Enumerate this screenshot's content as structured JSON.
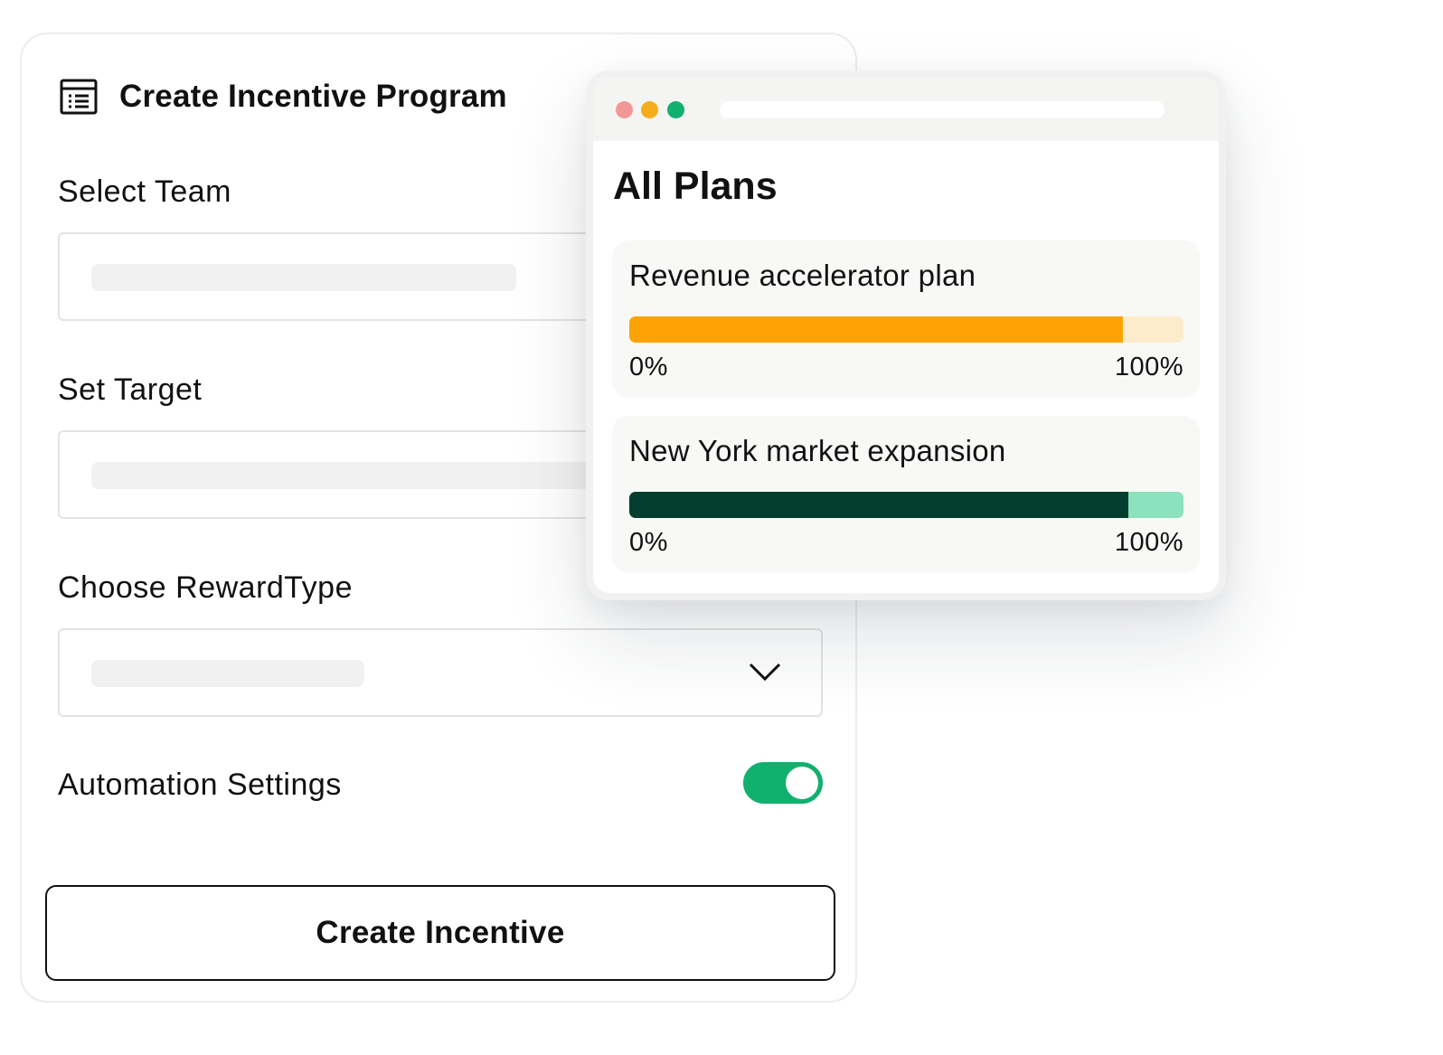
{
  "form": {
    "title": "Create Incentive Program",
    "fields": [
      {
        "label": "Select Team"
      },
      {
        "label": "Set Target"
      },
      {
        "label": "Choose RewardType"
      }
    ],
    "automation": {
      "label": "Automation Settings",
      "enabled": true
    },
    "submit_label": "Create Incentive"
  },
  "plans_window": {
    "title": "All Plans",
    "plans": [
      {
        "name": "Revenue accelerator plan",
        "progress_percent": 89,
        "fill_color": "#fda306",
        "track_color": "#fdeccb",
        "min_label": "0%",
        "max_label": "100%"
      },
      {
        "name": "New York market expansion",
        "progress_percent": 90,
        "fill_color": "#033d2d",
        "track_color": "#8be2bd",
        "min_label": "0%",
        "max_label": "100%"
      }
    ]
  },
  "colors": {
    "accent_green": "#12b06e",
    "traffic_red": "#f29797",
    "traffic_yellow": "#f5ad1c",
    "traffic_green": "#12b06e"
  },
  "icons": {
    "header": "list-document-icon",
    "dropdown": "chevron-down-icon"
  }
}
